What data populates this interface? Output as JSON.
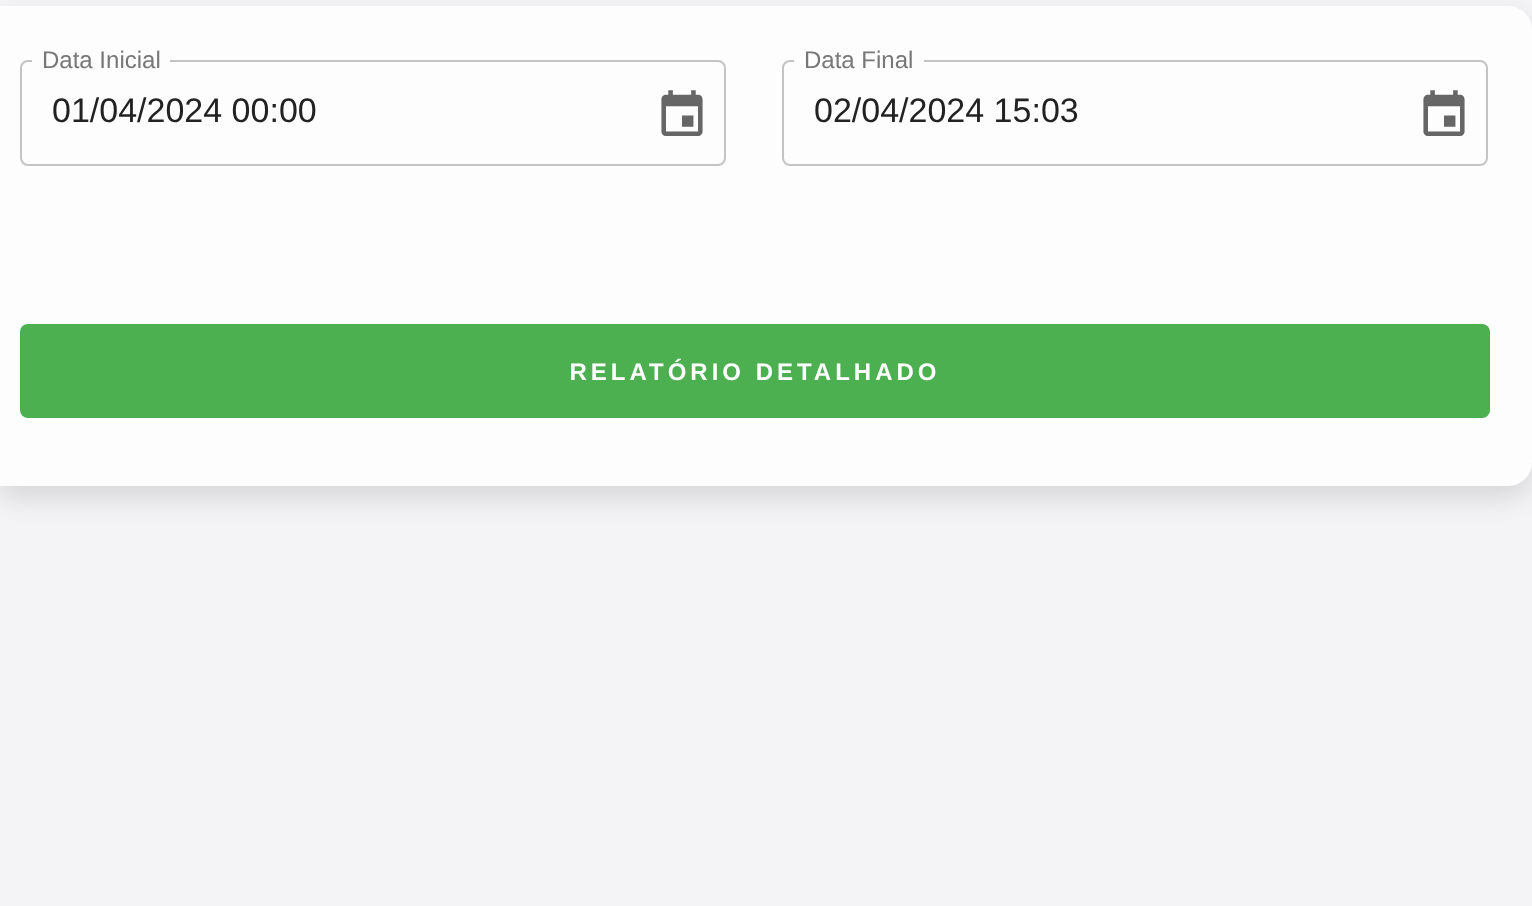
{
  "fields": [
    {
      "label": "Data Inicial",
      "value": "01/04/2024 00:00"
    },
    {
      "label": "Data Final",
      "value": "02/04/2024 15:03"
    }
  ],
  "button": "RELATÓRIO DETALHADO"
}
